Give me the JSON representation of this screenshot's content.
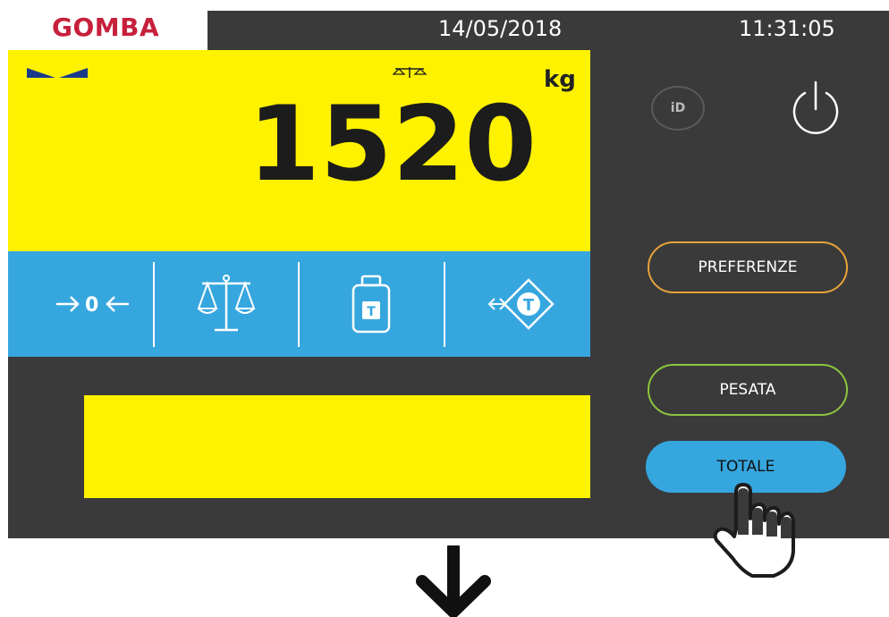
{
  "header": {
    "brand": "GOMBA",
    "date": "14/05/2018",
    "time": "11:31:05"
  },
  "display": {
    "weight": "1520",
    "unit": "kg"
  },
  "function_bar": {
    "zero_label": "0",
    "tare_label": "T",
    "preset_tare_label": "T"
  },
  "buttons": {
    "id_label": "iD",
    "preferenze": "PREFERENZE",
    "pesata": "PESATA",
    "totale": "TOTALE"
  },
  "colors": {
    "display_yellow": "#fff200",
    "function_blue": "#36a6df",
    "brand_red": "#c7203b",
    "preferenze_border": "#e8a33b",
    "pesata_border": "#8cc63f",
    "screen_bg": "#3a3a3a"
  },
  "icons": [
    "bowtie-indicator-icon",
    "stable-scale-icon",
    "zero-arrows-icon",
    "balance-icon",
    "tare-weight-icon",
    "preset-tare-icon",
    "power-icon",
    "hand-pointer-icon",
    "down-arrow-icon"
  ]
}
